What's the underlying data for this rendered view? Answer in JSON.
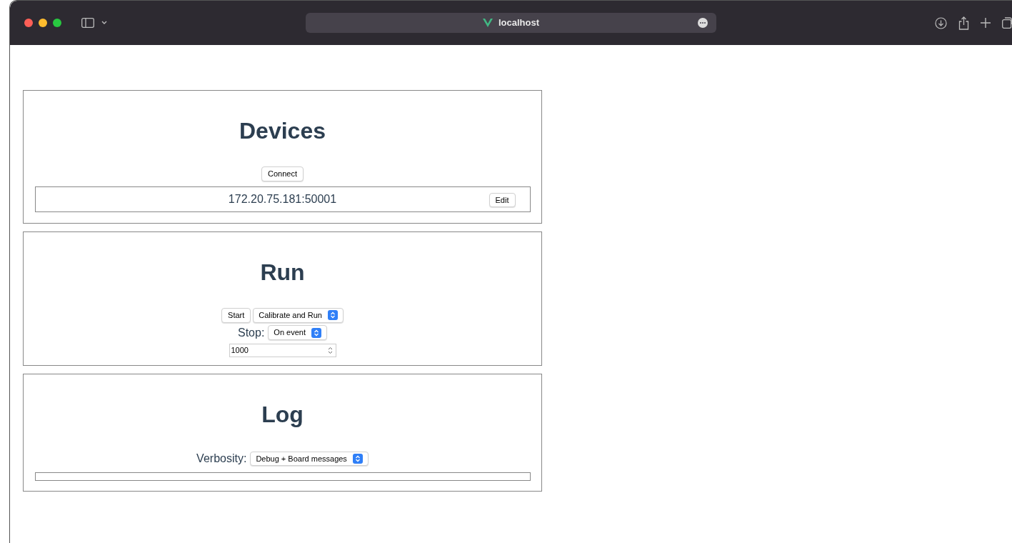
{
  "browser": {
    "address": "localhost"
  },
  "devices": {
    "title": "Devices",
    "connect_button": "Connect",
    "device": {
      "address": "172.20.75.181:50001",
      "edit_button": "Edit"
    }
  },
  "run": {
    "title": "Run",
    "start_button": "Start",
    "mode_select": "Calibrate and Run",
    "stop_label": "Stop:",
    "stop_select": "On event",
    "count_value": "1000"
  },
  "log": {
    "title": "Log",
    "verbosity_label": "Verbosity:",
    "verbosity_select": "Debug + Board messages"
  }
}
